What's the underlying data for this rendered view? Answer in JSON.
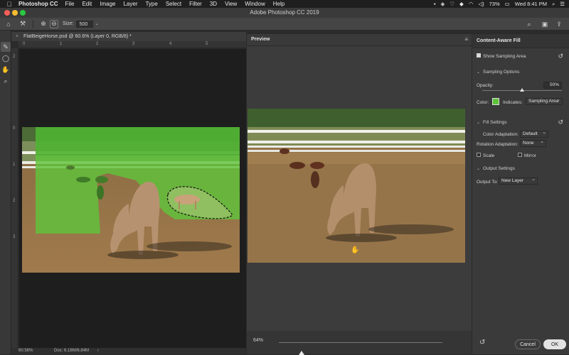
{
  "menubar": {
    "app": "Photoshop CC",
    "items": [
      "File",
      "Edit",
      "Image",
      "Layer",
      "Type",
      "Select",
      "Filter",
      "3D",
      "View",
      "Window",
      "Help"
    ],
    "battery": "73%",
    "clock": "Wed 8:41 PM"
  },
  "window": {
    "title": "Adobe Photoshop CC 2019"
  },
  "options": {
    "size_label": "Size:",
    "size_value": "500"
  },
  "document": {
    "tab_label": "FlatBeigeHorse.psd @ 60.6% (Layer 0, RGB/8) *",
    "ruler_h": [
      "0",
      "1",
      "2",
      "3",
      "4",
      "5"
    ],
    "ruler_v": [
      "2",
      "0",
      "1",
      "2",
      "3"
    ]
  },
  "status": {
    "zoom": "60.56%",
    "doc": "Doc: 6.18M/6.84M"
  },
  "preview": {
    "tab_label": "Preview",
    "zoom": "64%",
    "zoom_fraction": 0.14
  },
  "panel": {
    "title": "Content-Aware Fill",
    "show_sampling": "Show Sampling Area",
    "sampling_options": "Sampling Options",
    "opacity_label": "Opacity:",
    "opacity_value": "50%",
    "color_label": "Color:",
    "color_swatch": "#5ec33a",
    "indicates_label": "Indicates:",
    "indicates_value": "Sampling Area",
    "fill_settings": "Fill Settings",
    "color_adaptation_label": "Color Adaptation:",
    "color_adaptation_value": "Default",
    "rotation_adaptation_label": "Rotation Adaptation:",
    "rotation_adaptation_value": "None",
    "scale_label": "Scale",
    "mirror_label": "Mirror",
    "output_settings": "Output Settings",
    "output_to_label": "Output To:",
    "output_to_value": "New Layer",
    "cancel": "Cancel",
    "ok": "OK"
  }
}
